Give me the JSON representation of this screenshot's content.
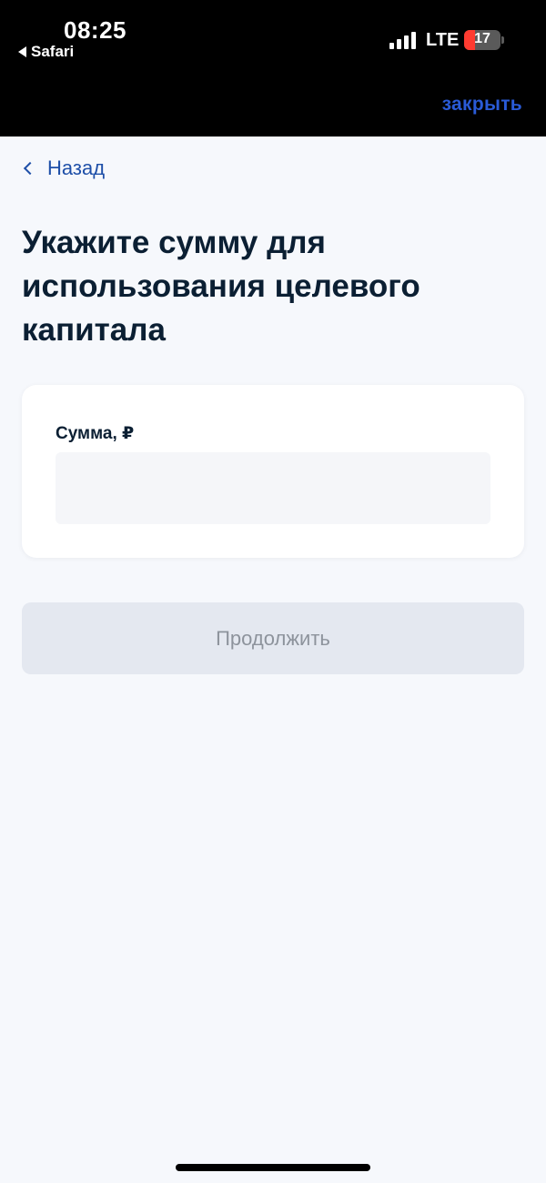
{
  "status_bar": {
    "time": "08:25",
    "back_app": "Safari",
    "network": "LTE",
    "battery": "17"
  },
  "header": {
    "close_label": "закрыть"
  },
  "nav": {
    "back_label": "Назад"
  },
  "page": {
    "title": "Укажите сумму для использования целевого капитала"
  },
  "form": {
    "amount_label": "Сумма, ₽",
    "amount_value": "",
    "continue_label": "Продолжить"
  },
  "colors": {
    "accent": "#2a5bd7",
    "link": "#1e4fa8",
    "title": "#0b1f33",
    "background": "#f6f8fc",
    "button_disabled_bg": "#e4e8f0",
    "battery_low": "#ff3b30"
  }
}
